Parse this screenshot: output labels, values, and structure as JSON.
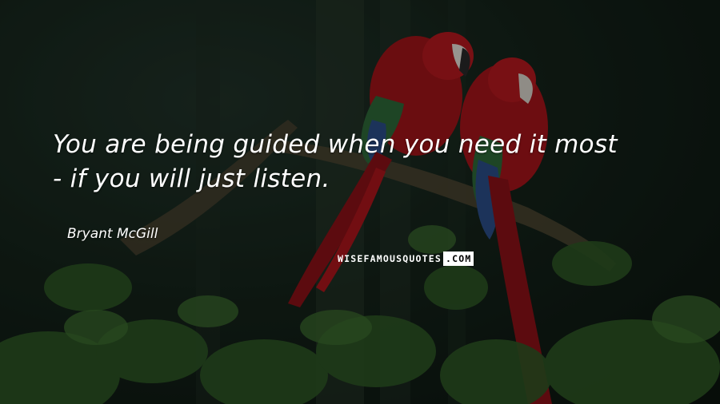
{
  "quote": {
    "line1": "You are being guided when you need it most",
    "line2": "-  if you will just listen."
  },
  "author": "Bryant McGill",
  "watermark": {
    "main": "WISEFAMOUSQUOTES",
    "tld": ".COM"
  },
  "colors": {
    "text": "#ffffff",
    "background": "#15241b",
    "parrot_red": "#b0161c",
    "leaf_green": "#2f5a26"
  }
}
